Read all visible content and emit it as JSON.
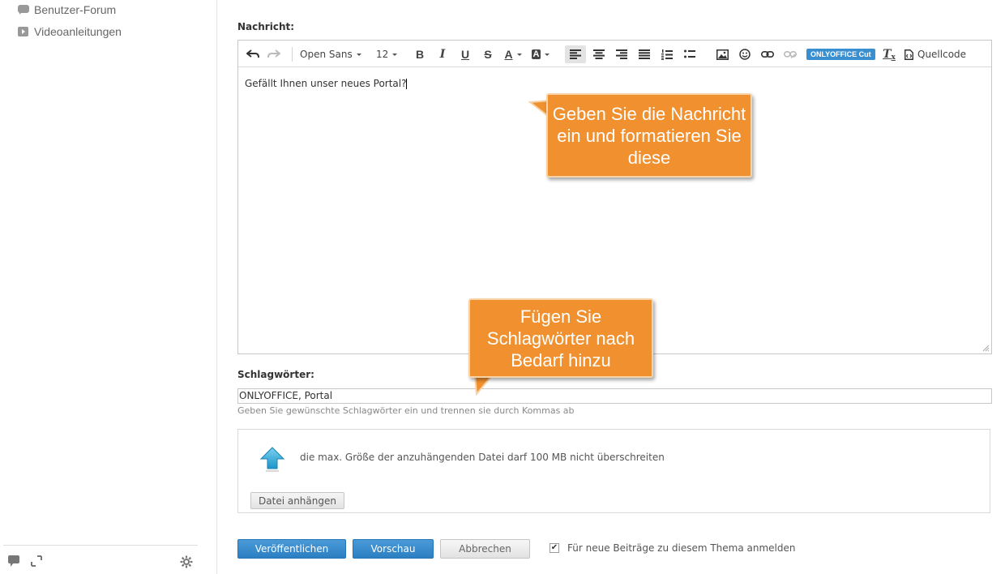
{
  "sidebar": {
    "items": [
      {
        "label": "Benutzer-Forum",
        "icon": "forum-icon"
      },
      {
        "label": "Videoanleitungen",
        "icon": "video-icon"
      }
    ],
    "footer": {
      "chat_icon": "chat-icon",
      "expand_icon": "expand-icon",
      "settings_icon": "gear-icon"
    }
  },
  "form": {
    "message_label": "Nachricht:",
    "toolbar": {
      "font_family": "Open Sans",
      "font_size": "12",
      "bold": "B",
      "italic": "I",
      "underline": "U",
      "strike": "S",
      "font_color": "A",
      "bg_color": "A",
      "onlyoffice_cut": "ONLYOFFICE Cut",
      "clear_format": "T",
      "source": "Quellcode"
    },
    "message_text": "Gefällt Ihnen unser neues Portal?",
    "tags_label": "Schlagwörter:",
    "tags_value": "ONLYOFFICE, Portal",
    "tags_hint": "Geben Sie gewünschte Schlagwörter ein und trennen sie durch Kommas ab",
    "attach_text": "die max. Größe der anzuhängenden Datei darf 100 MB nicht überschreiten",
    "attach_button": "Datei anhängen",
    "publish_button": "Veröffentlichen",
    "preview_button": "Vorschau",
    "cancel_button": "Abbrechen",
    "subscribe_label": "Für neue Beiträge zu diesem Thema anmelden",
    "subscribe_checked": true
  },
  "callouts": {
    "message": "Geben Sie die Nachricht ein und formatieren Sie diese",
    "tags": "Fügen Sie Schlagwörter nach Bedarf hinzu"
  },
  "colors": {
    "accent_blue": "#2b7fc2",
    "callout_orange": "#f0902f"
  }
}
